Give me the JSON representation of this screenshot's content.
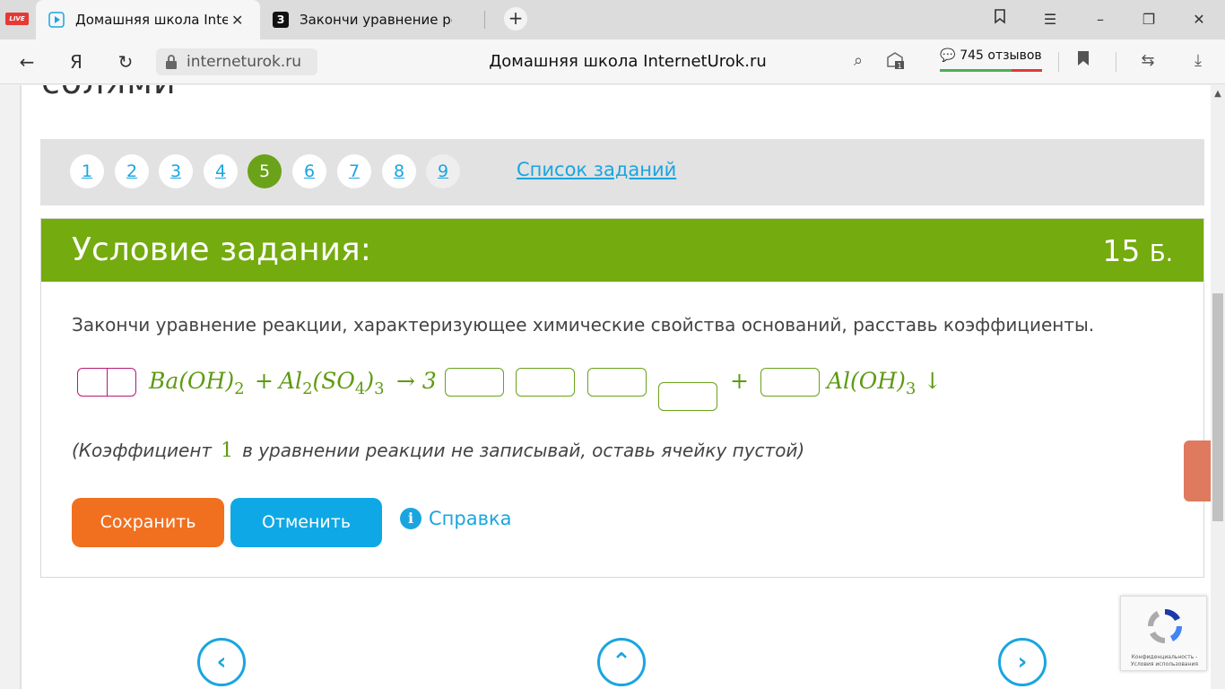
{
  "browser": {
    "tabs": [
      {
        "title": "Домашняя школа Intern",
        "active": true
      },
      {
        "title": "Закончи уравнение реакц",
        "active": false
      }
    ],
    "live_badge": "LIVE",
    "tab2_fav": "З",
    "address": "interneturok.ru",
    "page_title": "Домашняя школа InternetUrok.ru",
    "reviews": "745 отзывов",
    "badge_count": "1"
  },
  "page": {
    "heading_fragment": "солями",
    "pager": {
      "numbers": [
        "1",
        "2",
        "3",
        "4",
        "5",
        "6",
        "7",
        "8",
        "9"
      ],
      "current": "5",
      "task_list": "Список заданий"
    },
    "panel": {
      "title": "Условие задания:",
      "points": "15",
      "points_unit": "Б.",
      "task_text": "Закончи уравнение реакции, характеризующее химические свойства оснований, расставь коэффициенты.",
      "equation": {
        "reactant1": "Ba(OH)",
        "reactant1_sub": "2",
        "plus1": "+",
        "reactant2_a": "Al",
        "reactant2_sub1": "2",
        "reactant2_b": "(SO",
        "reactant2_sub2": "4",
        "reactant2_c": ")",
        "reactant2_sub3": "3",
        "arrow_coef": "→ 3",
        "plus2": "+",
        "product2": "Al(OH)",
        "product2_sub": "3",
        "precipitate": "↓"
      },
      "note_before": "(Коэффициент",
      "note_one": "1",
      "note_after": "в уравнении реакции не записывай, оставь ячейку пустой)",
      "save_label": "Сохранить",
      "cancel_label": "Отменить",
      "help_label": "Справка"
    },
    "recaptcha_text": "Конфиденциальность - Условия использования"
  },
  "colors": {
    "accent_green": "#74ab0e",
    "link_blue": "#1aa5e0",
    "save_orange": "#f07020"
  }
}
